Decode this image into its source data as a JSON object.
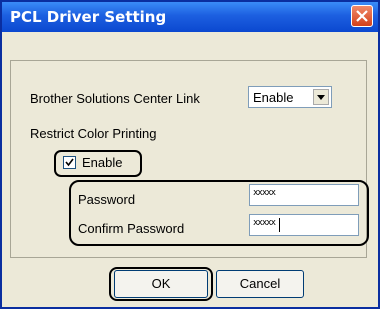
{
  "dialog": {
    "title": "PCL Driver Setting",
    "solutions_center_label": "Brother Solutions Center Link",
    "solutions_center_value": "Enable",
    "restrict_color_label": "Restrict Color Printing",
    "enable_checkbox_label": "Enable",
    "enable_checked": true,
    "password_label": "Password",
    "password_value": "xxxxx",
    "confirm_password_label": "Confirm Password",
    "confirm_password_value": "xxxxx",
    "ok_label": "OK",
    "cancel_label": "Cancel"
  },
  "colors": {
    "titlebar": "#0b48d0",
    "dialog_bg": "#ece9d8",
    "close": "#d4401a"
  },
  "icons": {
    "close": "close-icon",
    "dropdown": "chevron-down-icon",
    "check": "check-icon"
  }
}
